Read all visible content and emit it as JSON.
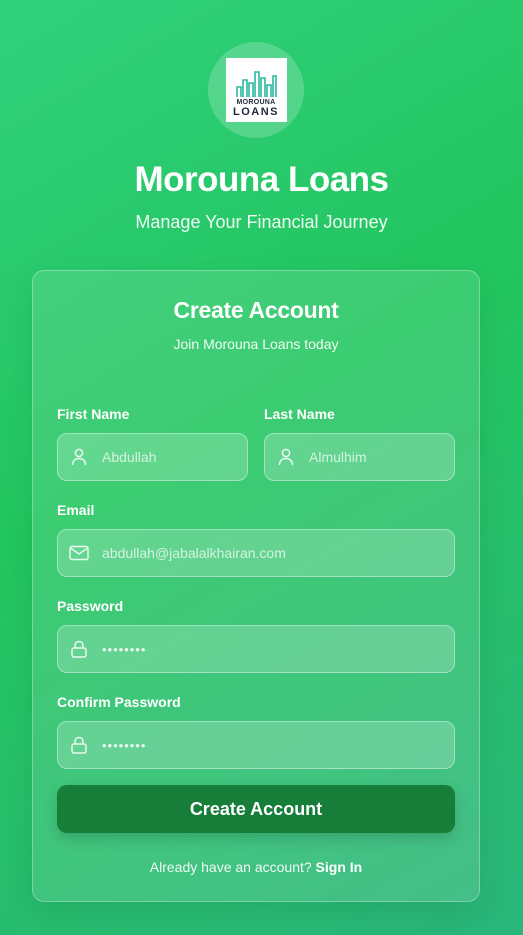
{
  "brand": {
    "logo_line1": "MOROUNA",
    "logo_line2": "LOANS",
    "title": "Morouna Loans",
    "tagline": "Manage Your Financial Journey"
  },
  "form": {
    "title": "Create Account",
    "subtitle": "Join Morouna Loans today",
    "first_name": {
      "label": "First Name",
      "placeholder": "Abdullah",
      "icon": "user-icon"
    },
    "last_name": {
      "label": "Last Name",
      "placeholder": "Almulhim",
      "icon": "user-icon"
    },
    "email": {
      "label": "Email",
      "placeholder": "abdullah@jabalalkhairan.com",
      "icon": "mail-icon"
    },
    "password": {
      "label": "Password",
      "masked_value": "••••••••",
      "icon": "lock-icon"
    },
    "confirm_password": {
      "label": "Confirm Password",
      "masked_value": "••••••••",
      "icon": "lock-icon"
    },
    "submit_label": "Create Account",
    "footer_text": "Already have an account?",
    "footer_link": "Sign In"
  },
  "colors": {
    "background_start": "#31d07d",
    "background_end": "#2ab57a",
    "button": "#177e3a",
    "text": "#ffffff"
  }
}
